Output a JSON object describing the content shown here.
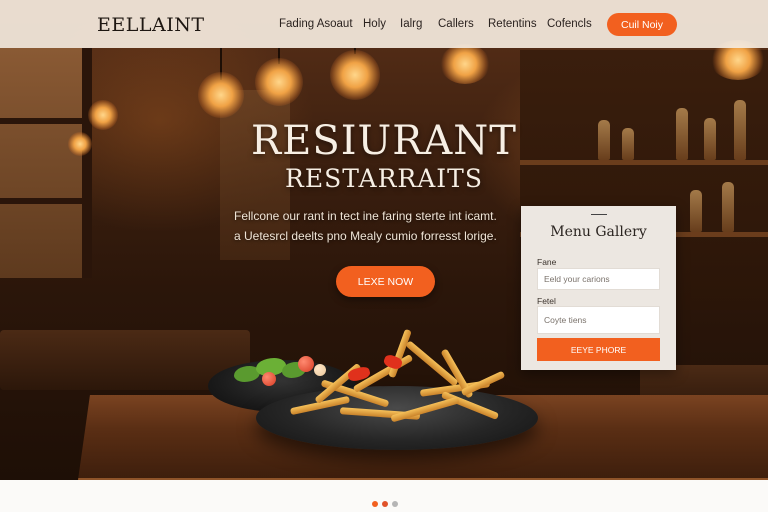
{
  "header": {
    "logo": "EELLAINT",
    "nav": [
      "Fading Asoaut",
      "Holy",
      "Ialrg",
      "Callers",
      "Retentins",
      "Cofencls"
    ],
    "cta_label": "Cuil Noiy"
  },
  "hero": {
    "title": "RESIURANT",
    "subtitle": "RESTARRAITS",
    "tagline": [
      "Fellcone our rant in tect ine faring sterte int icamt.",
      "a Uetesrcl deelts pno Mealy cumio forresst lorige."
    ],
    "button_label": "LEXE NOW"
  },
  "menu_gallery": {
    "title": "Menu Gallery",
    "field1_label": "Fane",
    "field1_placeholder": "Eeld your carions",
    "field2_label": "Fetel",
    "field2_placeholder": "Coyte tiens",
    "button_label": "EEYE PHORE"
  },
  "colors": {
    "accent": "#f2601f",
    "header_bg": "#f5ece0",
    "panel_bg": "#ece7e1"
  },
  "pagination": {
    "dots": [
      "active",
      "active",
      "inactive"
    ]
  }
}
